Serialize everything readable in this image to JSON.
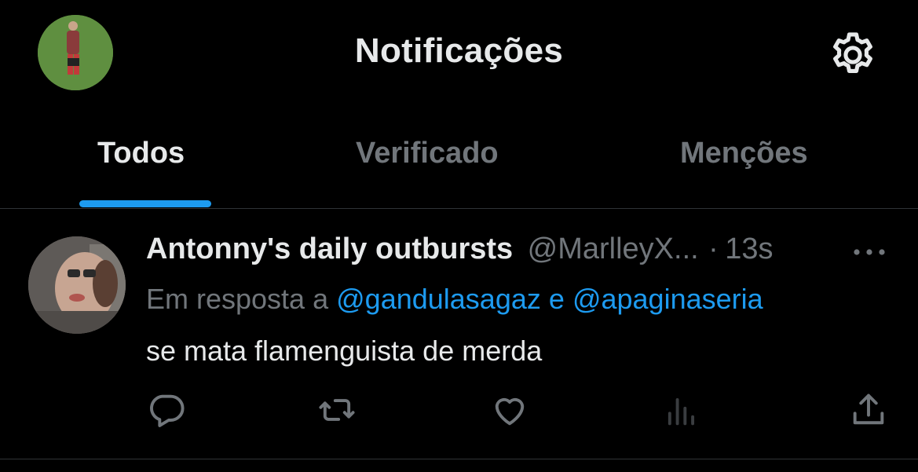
{
  "header": {
    "title": "Notificações",
    "avatar_icon": "profile-avatar",
    "settings_icon": "gear-icon"
  },
  "tabs": [
    {
      "label": "Todos",
      "active": true
    },
    {
      "label": "Verificado",
      "active": false
    },
    {
      "label": "Menções",
      "active": false
    }
  ],
  "post": {
    "display_name": "Antonny's daily outbursts",
    "handle": "@MarlleyX...",
    "separator": "·",
    "time": "13s",
    "reply_prefix": "Em resposta a",
    "reply_mention_1": "@gandulasagaz",
    "reply_joiner": "e",
    "reply_mention_2": "@apaginaseria",
    "text": "se mata flamenguista de merda",
    "actions": [
      "reply-icon",
      "repost-icon",
      "like-icon",
      "views-icon",
      "share-icon"
    ]
  },
  "colors": {
    "background": "#000000",
    "text": "#e7e9ea",
    "muted": "#71767b",
    "accent": "#1d9bf0",
    "divider": "#2f3336"
  }
}
